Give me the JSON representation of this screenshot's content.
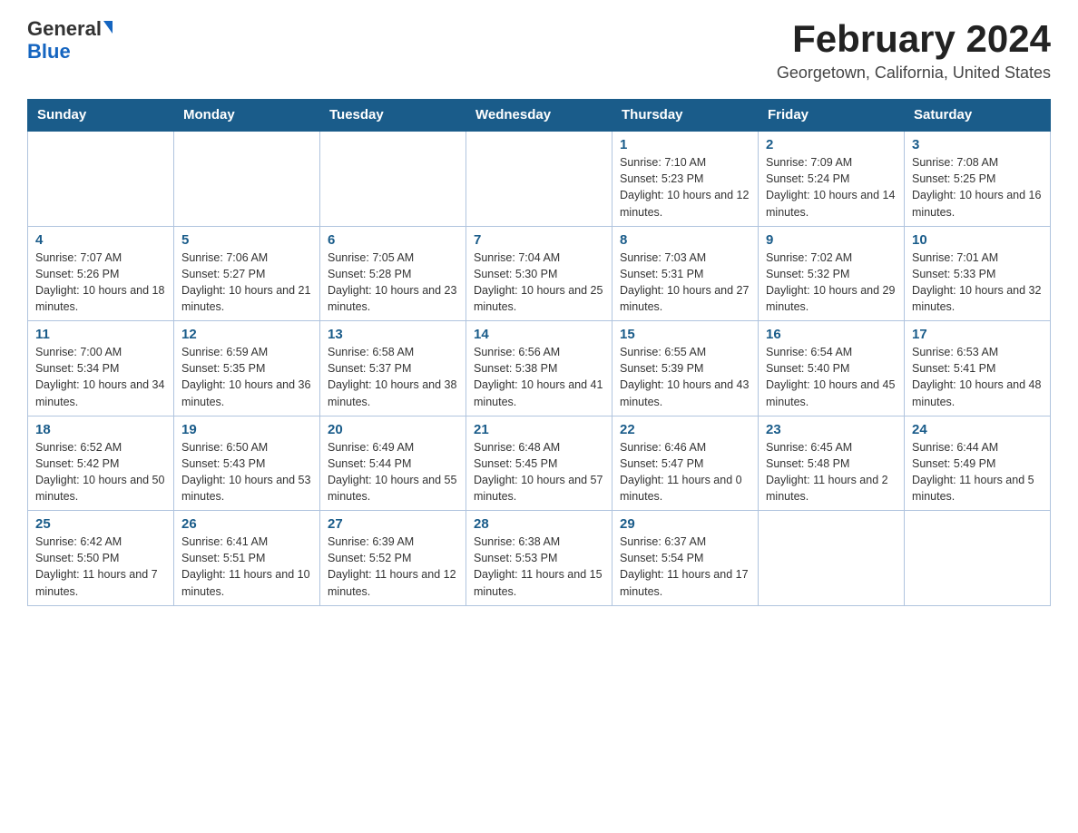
{
  "header": {
    "logo_general": "General",
    "logo_blue": "Blue",
    "title": "February 2024",
    "subtitle": "Georgetown, California, United States"
  },
  "days_of_week": [
    "Sunday",
    "Monday",
    "Tuesday",
    "Wednesday",
    "Thursday",
    "Friday",
    "Saturday"
  ],
  "weeks": [
    [
      {
        "day": "",
        "info": ""
      },
      {
        "day": "",
        "info": ""
      },
      {
        "day": "",
        "info": ""
      },
      {
        "day": "",
        "info": ""
      },
      {
        "day": "1",
        "info": "Sunrise: 7:10 AM\nSunset: 5:23 PM\nDaylight: 10 hours and 12 minutes."
      },
      {
        "day": "2",
        "info": "Sunrise: 7:09 AM\nSunset: 5:24 PM\nDaylight: 10 hours and 14 minutes."
      },
      {
        "day": "3",
        "info": "Sunrise: 7:08 AM\nSunset: 5:25 PM\nDaylight: 10 hours and 16 minutes."
      }
    ],
    [
      {
        "day": "4",
        "info": "Sunrise: 7:07 AM\nSunset: 5:26 PM\nDaylight: 10 hours and 18 minutes."
      },
      {
        "day": "5",
        "info": "Sunrise: 7:06 AM\nSunset: 5:27 PM\nDaylight: 10 hours and 21 minutes."
      },
      {
        "day": "6",
        "info": "Sunrise: 7:05 AM\nSunset: 5:28 PM\nDaylight: 10 hours and 23 minutes."
      },
      {
        "day": "7",
        "info": "Sunrise: 7:04 AM\nSunset: 5:30 PM\nDaylight: 10 hours and 25 minutes."
      },
      {
        "day": "8",
        "info": "Sunrise: 7:03 AM\nSunset: 5:31 PM\nDaylight: 10 hours and 27 minutes."
      },
      {
        "day": "9",
        "info": "Sunrise: 7:02 AM\nSunset: 5:32 PM\nDaylight: 10 hours and 29 minutes."
      },
      {
        "day": "10",
        "info": "Sunrise: 7:01 AM\nSunset: 5:33 PM\nDaylight: 10 hours and 32 minutes."
      }
    ],
    [
      {
        "day": "11",
        "info": "Sunrise: 7:00 AM\nSunset: 5:34 PM\nDaylight: 10 hours and 34 minutes."
      },
      {
        "day": "12",
        "info": "Sunrise: 6:59 AM\nSunset: 5:35 PM\nDaylight: 10 hours and 36 minutes."
      },
      {
        "day": "13",
        "info": "Sunrise: 6:58 AM\nSunset: 5:37 PM\nDaylight: 10 hours and 38 minutes."
      },
      {
        "day": "14",
        "info": "Sunrise: 6:56 AM\nSunset: 5:38 PM\nDaylight: 10 hours and 41 minutes."
      },
      {
        "day": "15",
        "info": "Sunrise: 6:55 AM\nSunset: 5:39 PM\nDaylight: 10 hours and 43 minutes."
      },
      {
        "day": "16",
        "info": "Sunrise: 6:54 AM\nSunset: 5:40 PM\nDaylight: 10 hours and 45 minutes."
      },
      {
        "day": "17",
        "info": "Sunrise: 6:53 AM\nSunset: 5:41 PM\nDaylight: 10 hours and 48 minutes."
      }
    ],
    [
      {
        "day": "18",
        "info": "Sunrise: 6:52 AM\nSunset: 5:42 PM\nDaylight: 10 hours and 50 minutes."
      },
      {
        "day": "19",
        "info": "Sunrise: 6:50 AM\nSunset: 5:43 PM\nDaylight: 10 hours and 53 minutes."
      },
      {
        "day": "20",
        "info": "Sunrise: 6:49 AM\nSunset: 5:44 PM\nDaylight: 10 hours and 55 minutes."
      },
      {
        "day": "21",
        "info": "Sunrise: 6:48 AM\nSunset: 5:45 PM\nDaylight: 10 hours and 57 minutes."
      },
      {
        "day": "22",
        "info": "Sunrise: 6:46 AM\nSunset: 5:47 PM\nDaylight: 11 hours and 0 minutes."
      },
      {
        "day": "23",
        "info": "Sunrise: 6:45 AM\nSunset: 5:48 PM\nDaylight: 11 hours and 2 minutes."
      },
      {
        "day": "24",
        "info": "Sunrise: 6:44 AM\nSunset: 5:49 PM\nDaylight: 11 hours and 5 minutes."
      }
    ],
    [
      {
        "day": "25",
        "info": "Sunrise: 6:42 AM\nSunset: 5:50 PM\nDaylight: 11 hours and 7 minutes."
      },
      {
        "day": "26",
        "info": "Sunrise: 6:41 AM\nSunset: 5:51 PM\nDaylight: 11 hours and 10 minutes."
      },
      {
        "day": "27",
        "info": "Sunrise: 6:39 AM\nSunset: 5:52 PM\nDaylight: 11 hours and 12 minutes."
      },
      {
        "day": "28",
        "info": "Sunrise: 6:38 AM\nSunset: 5:53 PM\nDaylight: 11 hours and 15 minutes."
      },
      {
        "day": "29",
        "info": "Sunrise: 6:37 AM\nSunset: 5:54 PM\nDaylight: 11 hours and 17 minutes."
      },
      {
        "day": "",
        "info": ""
      },
      {
        "day": "",
        "info": ""
      }
    ]
  ]
}
